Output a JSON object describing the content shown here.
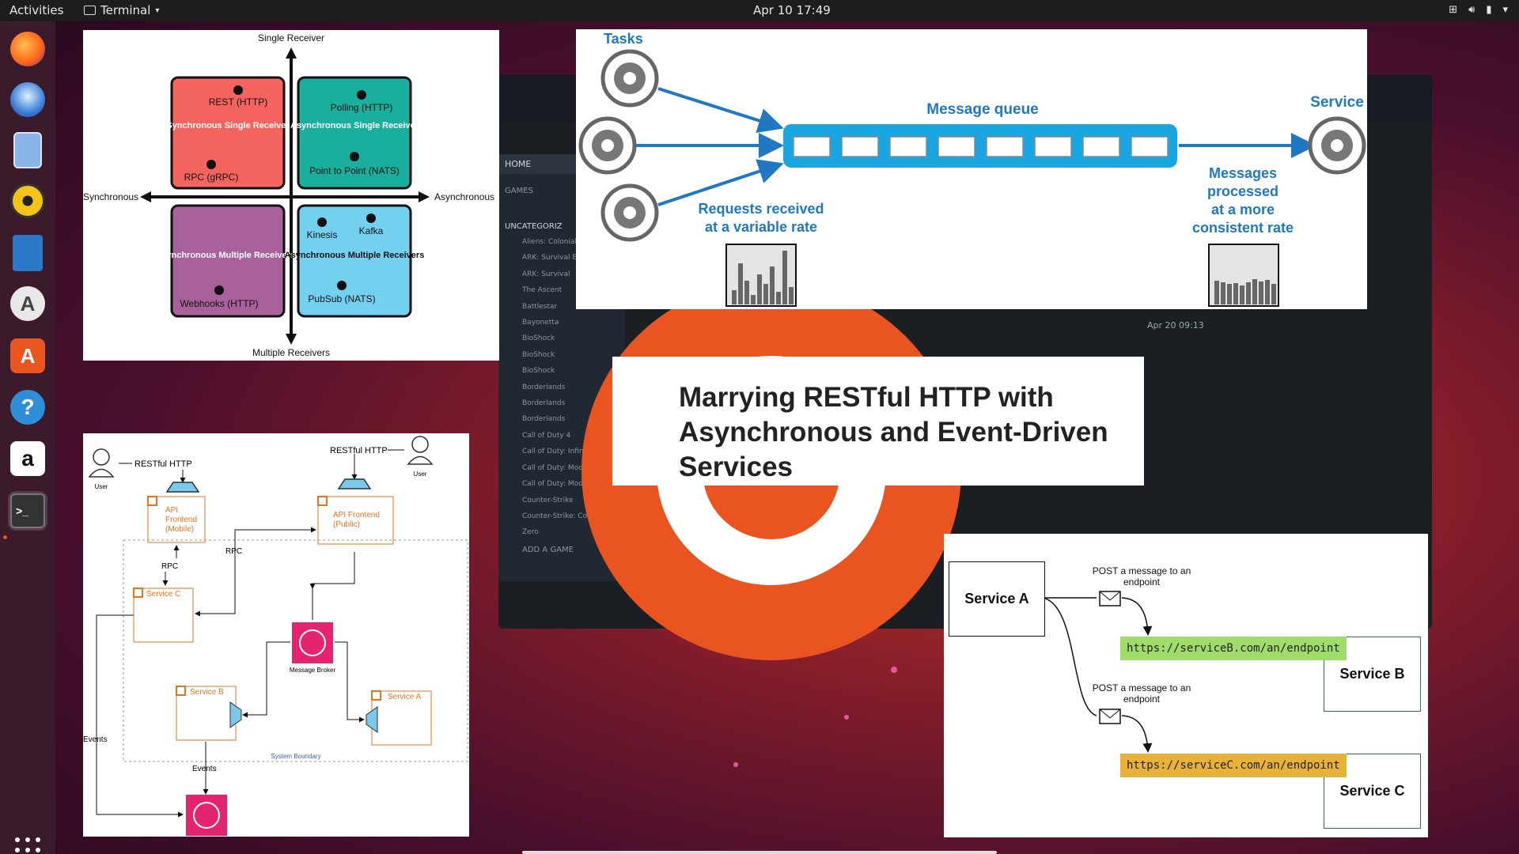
{
  "topbar": {
    "activities": "Activities",
    "app_name": "Terminal",
    "clock": "Apr 10  17:49"
  },
  "dock": {
    "apps": [
      {
        "name": "firefox-icon"
      },
      {
        "name": "thunderbird-icon"
      },
      {
        "name": "files-icon"
      },
      {
        "name": "rhythmbox-icon"
      },
      {
        "name": "writer-icon"
      },
      {
        "name": "software-updater-icon"
      },
      {
        "name": "app-store-icon"
      },
      {
        "name": "help-icon"
      },
      {
        "name": "amazon-icon"
      },
      {
        "name": "terminal-icon"
      }
    ]
  },
  "quadrant": {
    "top_label": "Single Receiver",
    "bottom_label": "Multiple Receivers",
    "left_label": "Synchronous",
    "right_label": "Asynchronous",
    "q1_title": "Synchronous Single Receiver",
    "q1_item1": "REST (HTTP)",
    "q1_item2": "RPC (gRPC)",
    "q2_title": "Asynchronous Single Receiver",
    "q2_item1": "Polling (HTTP)",
    "q2_item2": "Point to Point (NATS)",
    "q3_title": "Synchronous Multiple Receivers",
    "q3_item1": "Webhooks (HTTP)",
    "q4_title": "Asynchronous Multiple Receivers",
    "q4_item1": "Kinesis",
    "q4_item2": "Kafka",
    "q4_item3": "PubSub (NATS)",
    "colors": {
      "q1": "#f4645f",
      "q2": "#1aaf9c",
      "q3": "#a8619b",
      "q4": "#74d0ef"
    }
  },
  "queue": {
    "tasks_label": "Tasks",
    "queue_label": "Message queue",
    "service_label": "Service",
    "requests_label": [
      "Requests received",
      "at a variable rate"
    ],
    "processed_label": [
      "Messages",
      "processed",
      "at a more",
      "consistent rate"
    ],
    "accent": "#1aa6e0",
    "label_color": "#1f78c1"
  },
  "title_card": {
    "line1": "Marrying RESTful HTTP with",
    "line2": "Asynchronous and Event-Driven",
    "line3": "Services"
  },
  "architecture": {
    "user_left_label": "User",
    "user_right_label": "User",
    "http_left": "RESTful HTTP",
    "http_right": "RESTful HTTP",
    "api_mobile": [
      "API",
      "Frontend",
      "(Mobile)"
    ],
    "api_public": [
      "API Frontend",
      "(Public)"
    ],
    "rpc_label_left": "RPC",
    "rpc_label_mid": "RPC",
    "service_c": "Service C",
    "service_b": "Service B",
    "service_a": "Service A",
    "broker_label": "Message Broker",
    "boundary_label": "System Boundary",
    "events_left": "Events",
    "events_bottom": "Events",
    "orange": "#e8731c",
    "pink": "#e4246e"
  },
  "webhooks": {
    "service_a": "Service A",
    "service_b": "Service B",
    "service_c": "Service C",
    "post_note_1": [
      "POST a message to an",
      "endpoint"
    ],
    "post_note_2": [
      "POST a message to an",
      "endpoint"
    ],
    "url_b": "https://serviceB.com/an/endpoint",
    "url_c": "https://serviceC.com/an/endpoint",
    "url_b_color": "#9fdc6a",
    "url_c_color": "#e8b23a"
  },
  "steam_background": {
    "home": "HOME",
    "games": "GAMES",
    "uncategorized": "UNCATEGORIZ",
    "add_game": "ADD A GAME",
    "date": "Apr 20 09:13",
    "games_list": [
      "Aliens: Colonial M",
      "ARK: Survival E",
      "ARK: Survival",
      "The Ascent",
      "Battlestar",
      "Bayonetta",
      "BioShock",
      "BioShock",
      "BioShock",
      "Borderlands",
      "Borderlands",
      "Borderlands",
      "Call of Duty 4",
      "Call of Duty: Infin",
      "Call of Duty: Moder",
      "Call of Duty: Modern W",
      "Counter-Strike",
      "Counter-Strike: Condition Zero"
    ]
  }
}
